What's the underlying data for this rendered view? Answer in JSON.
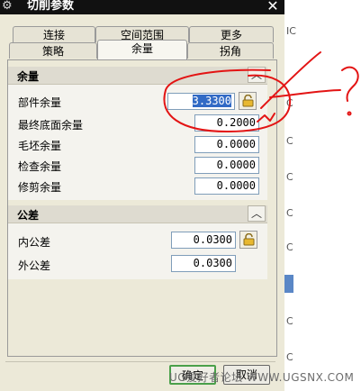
{
  "window": {
    "title": "切削参数",
    "close": "✕",
    "icon": "gear-icon"
  },
  "tabs_row1": [
    {
      "label": "连接"
    },
    {
      "label": "空间范围"
    },
    {
      "label": "更多"
    }
  ],
  "tabs_row2": [
    {
      "label": "策略"
    },
    {
      "label": "余量",
      "active": true
    },
    {
      "label": "拐角"
    }
  ],
  "stock_section": {
    "title": "余量",
    "toggle_icon": "chevron-up-icon",
    "rows": [
      {
        "label": "部件余量",
        "value": "3.3300",
        "selected": true,
        "lock": true
      },
      {
        "label": "最终底面余量",
        "value": "0.2000"
      },
      {
        "label": "毛坯余量",
        "value": "0.0000"
      },
      {
        "label": "检查余量",
        "value": "0.0000"
      },
      {
        "label": "修剪余量",
        "value": "0.0000"
      }
    ]
  },
  "tolerance_section": {
    "title": "公差",
    "toggle_icon": "chevron-up-icon",
    "rows": [
      {
        "label": "内公差",
        "value": "0.0300",
        "lock": true
      },
      {
        "label": "外公差",
        "value": "0.0300"
      }
    ]
  },
  "buttons": {
    "ok": "确定",
    "cancel": "取消"
  },
  "watermark": "UG爱好者论坛 WWW.UGSNX.COM",
  "side_panel": {
    "letter": "C",
    "top_letters": "IC"
  },
  "colors": {
    "selection": "#316ac5",
    "annotation": "#e31414",
    "ok_border": "#4aa04a"
  }
}
